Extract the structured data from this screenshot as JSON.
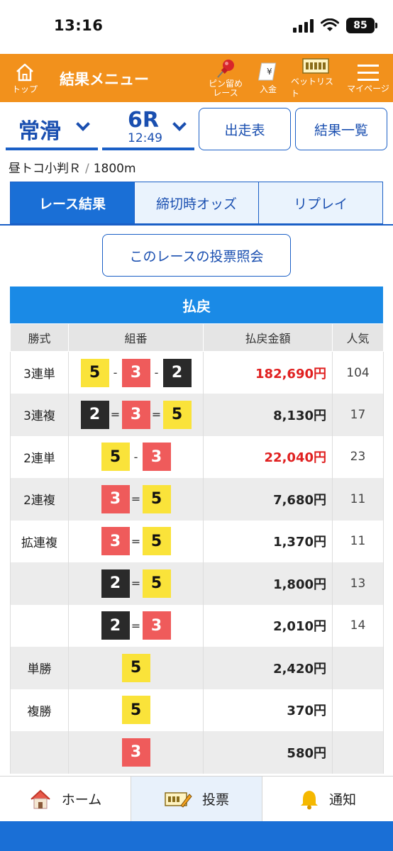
{
  "status": {
    "time": "13:16",
    "battery": "85"
  },
  "header": {
    "home_label": "トップ",
    "title": "結果メニュー",
    "pin_label_1": "ピン留め",
    "pin_label_2": "レース",
    "deposit_label": "入金",
    "betlist_label": "ベットリスト",
    "mypage_label": "マイページ"
  },
  "race": {
    "venue": "常滑",
    "race_no": "6R",
    "time": "12:49",
    "entry_table_label": "出走表",
    "results_list_label": "結果一覧",
    "name": "昼トコ小判Ｒ",
    "separator": "/",
    "distance": "1800m"
  },
  "tabs": [
    "レース結果",
    "締切時オッズ",
    "リプレイ"
  ],
  "inquiry_button": "このレースの投票照会",
  "payout": {
    "title": "払戻",
    "headers": [
      "勝式",
      "組番",
      "払戻金額",
      "人気"
    ],
    "rows": [
      {
        "type": "3連単",
        "combo": [
          "5",
          "-",
          "3",
          "-",
          "2"
        ],
        "amount": "182,690円",
        "popularity": "104"
      },
      {
        "type": "3連複",
        "combo": [
          "2",
          "=",
          "3",
          "=",
          "5"
        ],
        "amount": "8,130円",
        "popularity": "17"
      },
      {
        "type": "2連単",
        "combo": [
          "5",
          "-",
          "3"
        ],
        "amount": "22,040円",
        "popularity": "23"
      },
      {
        "type": "2連複",
        "combo": [
          "3",
          "=",
          "5"
        ],
        "amount": "7,680円",
        "popularity": "11"
      },
      {
        "type": "拡連複",
        "combo": [
          "3",
          "=",
          "5"
        ],
        "amount": "1,370円",
        "popularity": "11"
      },
      {
        "type": "",
        "combo": [
          "2",
          "=",
          "5"
        ],
        "amount": "1,800円",
        "popularity": "13"
      },
      {
        "type": "",
        "combo": [
          "2",
          "=",
          "3"
        ],
        "amount": "2,010円",
        "popularity": "14"
      },
      {
        "type": "単勝",
        "combo": [
          "5"
        ],
        "amount": "2,420円",
        "popularity": ""
      },
      {
        "type": "複勝",
        "combo": [
          "5"
        ],
        "amount": "370円",
        "popularity": ""
      },
      {
        "type": "",
        "combo": [
          "3"
        ],
        "amount": "580円",
        "popularity": ""
      }
    ]
  },
  "bottom_nav": {
    "home": "ホーム",
    "vote": "投票",
    "notify": "通知"
  },
  "colors": {
    "header_orange": "#f2911c",
    "brand_blue": "#1a6fd6",
    "amount_red": "#e02020",
    "boat2": "#2a2a2a",
    "boat3": "#ef5b5b",
    "boat5": "#fae33a"
  }
}
